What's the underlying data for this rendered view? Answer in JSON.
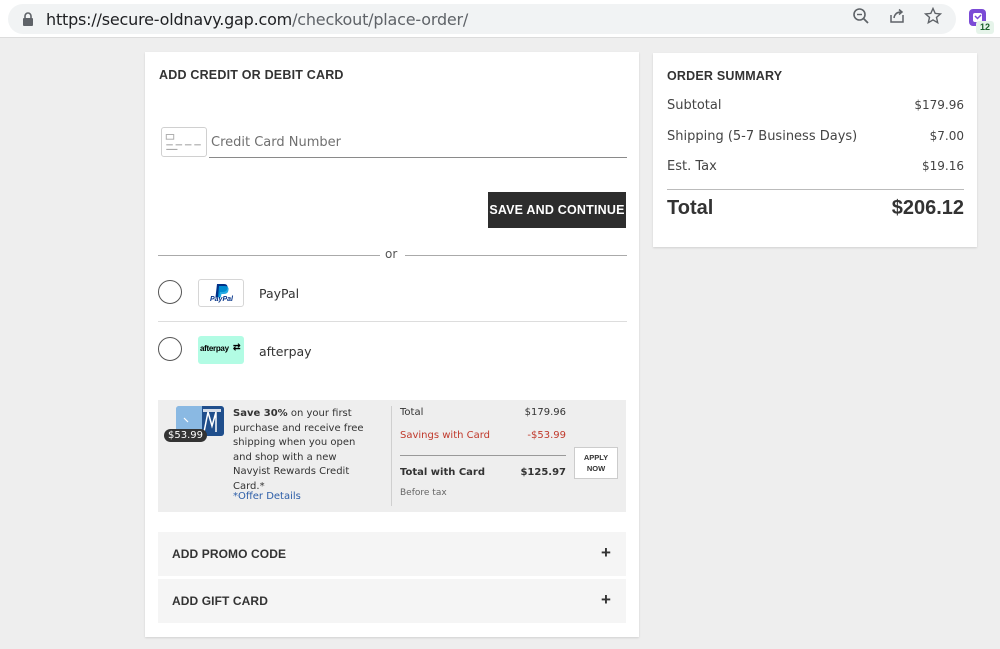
{
  "browser": {
    "url_host": "https://secure-oldnavy.gap.com",
    "url_path": "/checkout/place-order/",
    "extension_badge": "12"
  },
  "payment": {
    "title": "ADD CREDIT OR DEBIT CARD",
    "card_placeholder": "Credit Card Number",
    "save_button": "SAVE AND CONTINUE",
    "or_text": "or",
    "paypal_logo_text": "PayPal",
    "paypal_label": "PayPal",
    "afterpay_logo_text": "afterpay",
    "afterpay_label": "afterpay"
  },
  "rewards": {
    "card_price": "$53.99",
    "text_bold": "Save 30%",
    "text_rest": " on your first purchase and receive free shipping when you open and shop with a new Navyist Rewards Credit Card.*",
    "offer_link": "*Offer Details",
    "total_label": "Total",
    "total_value": "$179.96",
    "savings_label": "Savings with Card",
    "savings_value": "-$53.99",
    "total_card_label": "Total with Card",
    "total_card_value": "$125.97",
    "before_tax": "Before tax",
    "apply_line1": "APPLY",
    "apply_line2": "NOW"
  },
  "accordions": {
    "promo": "ADD PROMO CODE",
    "gift": "ADD GIFT CARD",
    "expand_symbol": "+"
  },
  "summary": {
    "title": "ORDER SUMMARY",
    "subtotal_label": "Subtotal",
    "subtotal_value": "$179.96",
    "shipping_label": "Shipping (5-7 Business Days)",
    "shipping_value": "$7.00",
    "tax_label": "Est. Tax",
    "tax_value": "$19.16",
    "total_label": "Total",
    "total_value": "$206.12"
  },
  "colors": {
    "button_dark": "#2d2d2d",
    "savings_red": "#c0392b",
    "link_blue": "#2d5ea8",
    "afterpay_mint": "#b2fce4",
    "paypal_blue": "#003087"
  }
}
